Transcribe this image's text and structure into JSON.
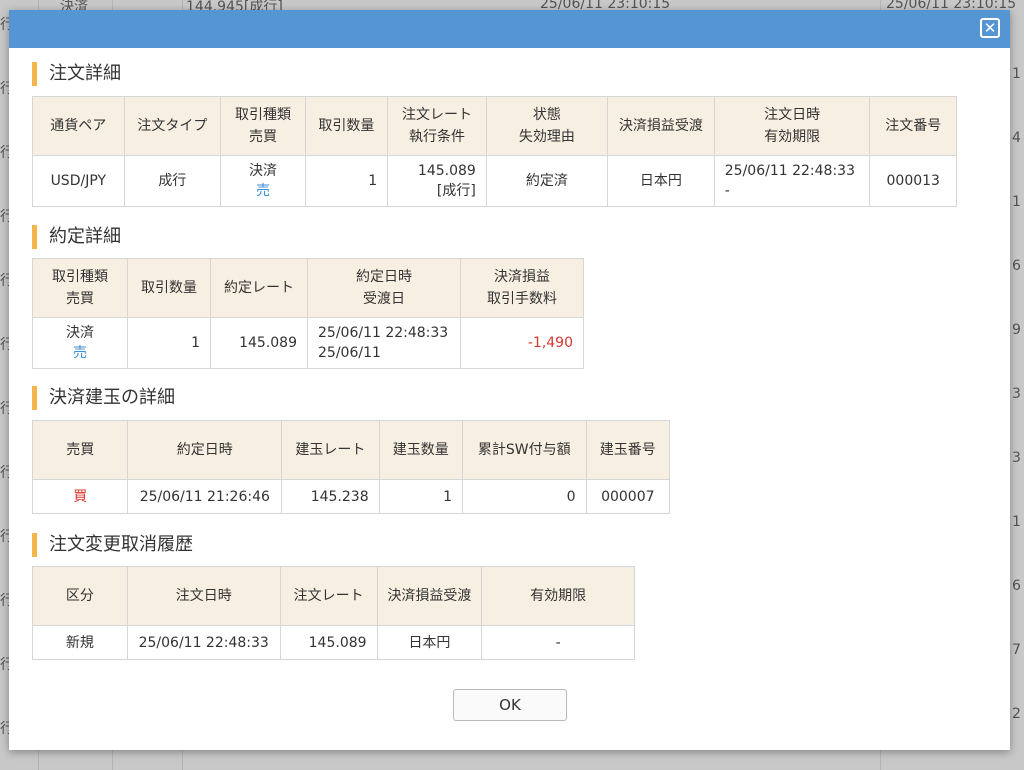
{
  "background": {
    "top_row": [
      "決済",
      "144.945[成行]",
      "25/06/11 23:10:15",
      "25/06/11 23:10:15"
    ],
    "left_col": [
      "行",
      "行",
      "行",
      "行",
      "行",
      "行",
      "行",
      "行",
      "行",
      "行",
      "行",
      "行"
    ],
    "right_col": [
      "1",
      "4",
      "1",
      "6",
      "9",
      "3",
      "3",
      "1",
      "6",
      "7",
      "2"
    ]
  },
  "dialog": {
    "close_label": "✕",
    "ok_label": "OK"
  },
  "order_details": {
    "title": "注文詳細",
    "headers": [
      [
        "通貨ペア"
      ],
      [
        "注文タイプ"
      ],
      [
        "取引種類",
        "売買"
      ],
      [
        "取引数量"
      ],
      [
        "注文レート",
        "執行条件"
      ],
      [
        "状態",
        "失効理由"
      ],
      [
        "決済損益受渡"
      ],
      [
        "注文日時",
        "有効期限"
      ],
      [
        "注文番号"
      ]
    ],
    "row": {
      "pair": "USD/JPY",
      "type": "成行",
      "trade_kind": "決済",
      "side": "売",
      "quantity": "1",
      "rate": "145.089",
      "condition": "[成行]",
      "status": "約定済",
      "settlement": "日本円",
      "order_datetime": "25/06/11 22:48:33",
      "expiry": "-",
      "order_no": "000013"
    }
  },
  "execution_details": {
    "title": "約定詳細",
    "headers": [
      [
        "取引種類",
        "売買"
      ],
      [
        "取引数量"
      ],
      [
        "約定レート"
      ],
      [
        "約定日時",
        "受渡日"
      ],
      [
        "決済損益",
        "取引手数料"
      ]
    ],
    "row": {
      "trade_kind": "決済",
      "side": "売",
      "quantity": "1",
      "rate": "145.089",
      "exec_datetime": "25/06/11 22:48:33",
      "delivery_date": "25/06/11",
      "pnl": "-1,490"
    }
  },
  "position_details": {
    "title": "決済建玉の詳細",
    "headers": [
      "売買",
      "約定日時",
      "建玉レート",
      "建玉数量",
      "累計SW付与額",
      "建玉番号"
    ],
    "row": {
      "side": "買",
      "exec_datetime": "25/06/11 21:26:46",
      "rate": "145.238",
      "quantity": "1",
      "swap": "0",
      "position_no": "000007"
    }
  },
  "change_history": {
    "title": "注文変更取消履歴",
    "headers": [
      "区分",
      "注文日時",
      "注文レート",
      "決済損益受渡",
      "有効期限"
    ],
    "row": {
      "category": "新規",
      "order_datetime": "25/06/11 22:48:33",
      "rate": "145.089",
      "settlement": "日本円",
      "expiry": "-"
    }
  }
}
